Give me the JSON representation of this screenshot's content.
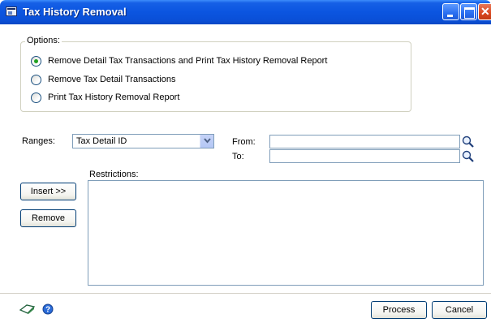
{
  "window": {
    "title": "Tax History Removal"
  },
  "options": {
    "label": "Options:",
    "items": [
      {
        "label": "Remove Detail Tax Transactions and Print Tax History Removal Report",
        "selected": true
      },
      {
        "label": "Remove Tax Detail Transactions",
        "selected": false
      },
      {
        "label": "Print Tax History Removal Report",
        "selected": false
      }
    ]
  },
  "ranges": {
    "label": "Ranges:",
    "selected": "Tax Detail ID"
  },
  "from": {
    "label": "From:",
    "value": ""
  },
  "to": {
    "label": "To:",
    "value": ""
  },
  "restrictions": {
    "label": "Restrictions:"
  },
  "buttons": {
    "insert": "Insert >>",
    "remove": "Remove",
    "process": "Process",
    "cancel": "Cancel"
  },
  "icons": [
    "window-icon",
    "minimize-icon",
    "maximize-icon",
    "close-icon",
    "dropdown-arrow-icon",
    "lookup-icon",
    "note-icon",
    "help-icon"
  ]
}
